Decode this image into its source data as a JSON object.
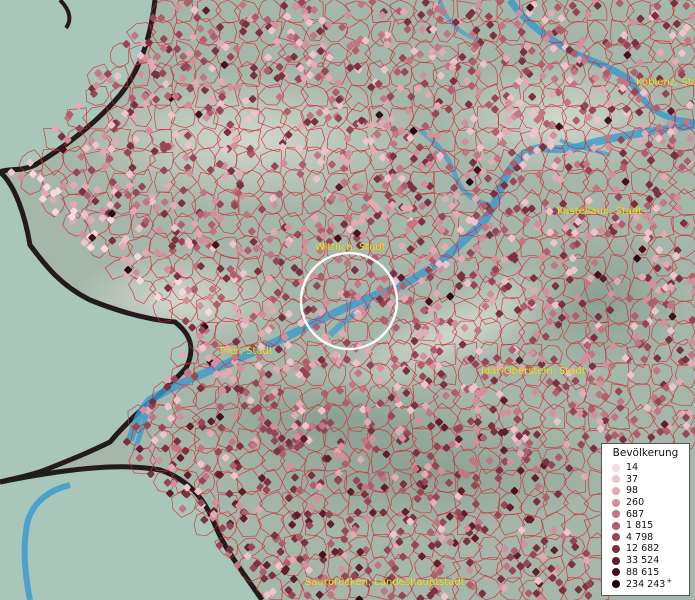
{
  "map": {
    "cities": [
      {
        "id": "koblenz",
        "name": "Koblenz, Stadt"
      },
      {
        "id": "kastellaun",
        "name": "Kastellaun, Stadt"
      },
      {
        "id": "wittlich",
        "name": "Wittlich, Stadt"
      },
      {
        "id": "trier",
        "name": "Trier, Stadt"
      },
      {
        "id": "idar",
        "name": "Idar-Oberstein, Stadt"
      },
      {
        "id": "saarbruecken",
        "name": "Saarbrücken, Landeshauptstadt"
      }
    ],
    "dot_colors": [
      "#f6d9df",
      "#eec3cd",
      "#e3a9b5",
      "#d38f9c",
      "#c27583",
      "#b05d6c",
      "#964657",
      "#7a3142",
      "#5e1e2e",
      "#44111e",
      "#2c0812",
      "#15030a"
    ]
  },
  "legend": {
    "title": "Bevölkerung",
    "items": [
      {
        "label": "14",
        "color": "#f6d9df"
      },
      {
        "label": "37",
        "color": "#eec3cd"
      },
      {
        "label": "98",
        "color": "#e3a9b5"
      },
      {
        "label": "260",
        "color": "#d38f9c"
      },
      {
        "label": "687",
        "color": "#c27583"
      },
      {
        "label": "1 815",
        "color": "#b05d6c"
      },
      {
        "label": "4 798",
        "color": "#964657"
      },
      {
        "label": "12 682",
        "color": "#7a3142"
      },
      {
        "label": "33 524",
        "color": "#5e1e2e"
      },
      {
        "label": "88 615",
        "color": "#44111e"
      },
      {
        "label": "234 243",
        "color": "#15030a"
      }
    ],
    "plus_sign": "+"
  }
}
